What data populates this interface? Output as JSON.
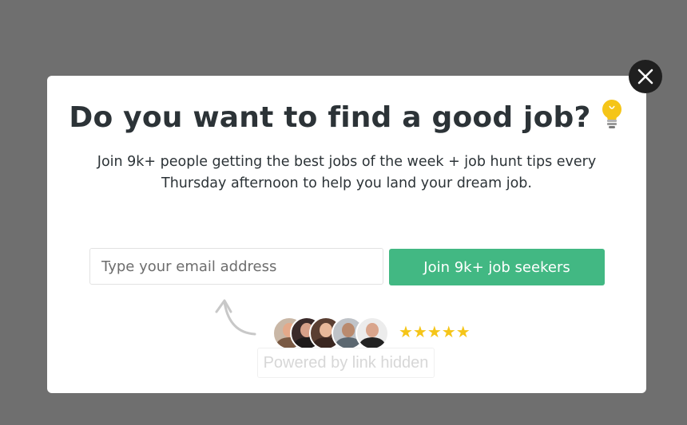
{
  "modal": {
    "title": "Do you want to find a good job?",
    "title_icon": "lightbulb-icon",
    "subtitle": "Join 9k+ people getting the best jobs of the week + job hunt tips every Thursday afternoon to help you land your dream job.",
    "email_placeholder": "Type your email address",
    "email_value": "",
    "submit_label": "Join 9k+ job seekers",
    "close_icon": "close-icon",
    "rating_stars": 5,
    "stars_text": "★★★★★",
    "powered_by": "Powered by link hidden"
  },
  "colors": {
    "overlay": "#6f6f6f",
    "accent": "#42b883",
    "star": "#f5c518",
    "close_bg": "#1f1f1f"
  }
}
